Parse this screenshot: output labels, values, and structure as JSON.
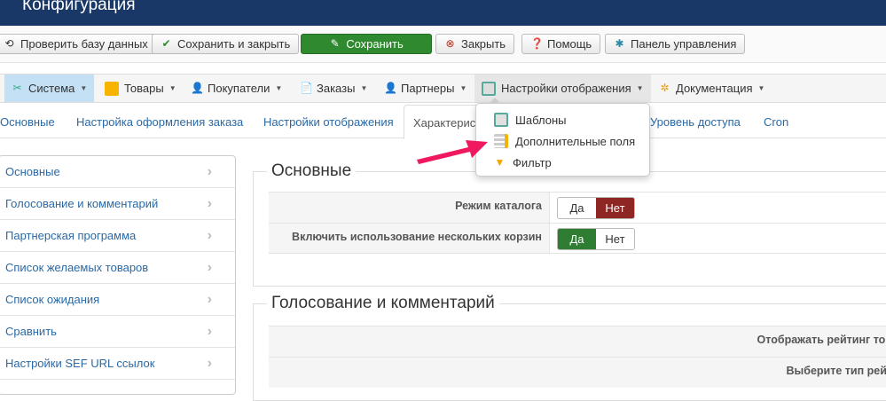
{
  "header": {
    "title": "Конфигурация"
  },
  "toolbar": {
    "check_db": "Проверить базу данных",
    "save_close": "Сохранить и закрыть",
    "save": "Сохранить",
    "close": "Закрыть",
    "help": "Помощь",
    "control_panel": "Панель управления"
  },
  "menu": {
    "items": [
      "Система",
      "Товары",
      "Покупатели",
      "Заказы",
      "Партнеры",
      "Настройки отображения",
      "Документация"
    ],
    "dropdown": [
      "Шаблоны",
      "Дополнительные поля",
      "Фильтр"
    ]
  },
  "tabs": [
    "Основные",
    "Настройка оформления заказа",
    "Настройки отображения",
    "Характеристики",
    "Уровень доступа",
    "Cron"
  ],
  "sidebar": [
    "Основные",
    "Голосование и комментарий",
    "Партнерская программа",
    "Список желаемых товаров",
    "Список ожидания",
    "Сравнить",
    "Настройки SEF URL ссылок"
  ],
  "sections": {
    "main": {
      "title": "Основные",
      "rows": [
        {
          "label": "Режим каталога",
          "value": "Нет"
        },
        {
          "label": "Включить использование нескольких корзин",
          "value": "Да"
        }
      ]
    },
    "voting": {
      "title": "Голосование и комментарий",
      "rows": [
        "Отображать рейтинг тов",
        "Выберите тип рейт"
      ]
    }
  },
  "yes": "Да",
  "no": "Нет",
  "colors": {
    "header": "#1a3867",
    "save": "#2f8a2f",
    "no_active": "#8e2624",
    "yes_active": "#2f7d32",
    "arrow": "#f0185f"
  }
}
